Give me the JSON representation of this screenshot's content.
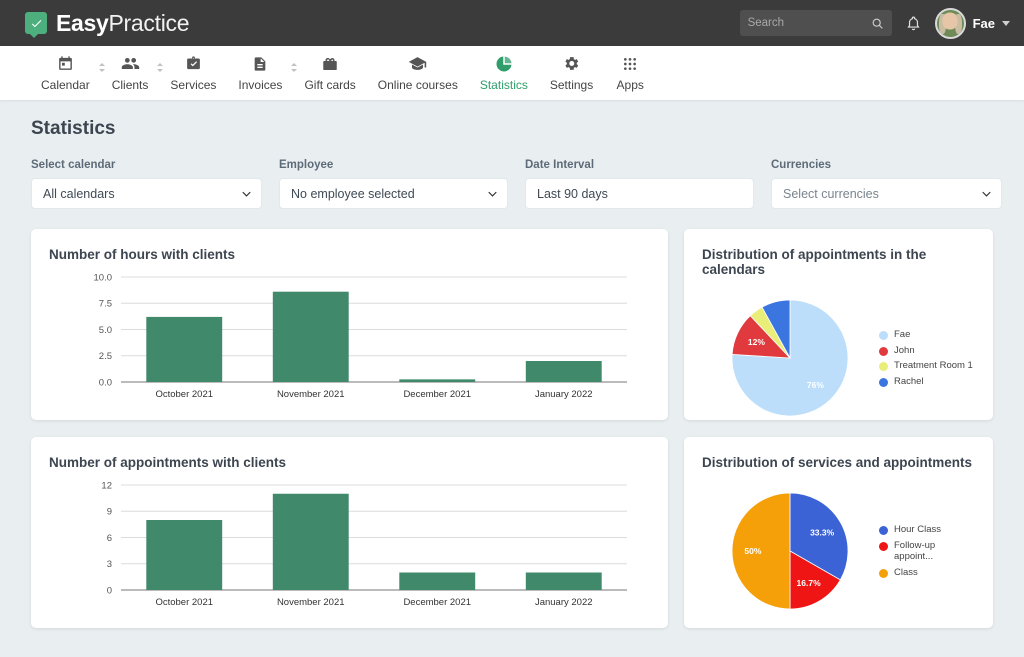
{
  "topbar": {
    "logo_bold": "Easy",
    "logo_light": "Practice",
    "logo_icon": "check-badge-icon",
    "search_placeholder": "Search",
    "search_value": "",
    "search_icon": "search-icon",
    "bell_icon": "notification-bell-icon",
    "user_name": "Fae",
    "user_caret_icon": "chevron-down-icon"
  },
  "nav": {
    "items": [
      {
        "label": "Calendar",
        "icon": "calendar-icon",
        "active": false,
        "has_stepper": true
      },
      {
        "label": "Clients",
        "icon": "people-icon",
        "active": false,
        "has_stepper": true
      },
      {
        "label": "Services",
        "icon": "briefcase-check-icon",
        "active": false,
        "has_stepper": false
      },
      {
        "label": "Invoices",
        "icon": "document-icon",
        "active": false,
        "has_stepper": true
      },
      {
        "label": "Gift cards",
        "icon": "gift-card-icon",
        "active": false,
        "has_stepper": false
      },
      {
        "label": "Online courses",
        "icon": "graduation-cap-icon",
        "active": false,
        "has_stepper": false
      },
      {
        "label": "Statistics",
        "icon": "pie-chart-icon",
        "active": true,
        "has_stepper": false
      },
      {
        "label": "Settings",
        "icon": "gear-icon",
        "active": false,
        "has_stepper": false
      },
      {
        "label": "Apps",
        "icon": "grid-apps-icon",
        "active": false,
        "has_stepper": false
      }
    ]
  },
  "page": {
    "title": "Statistics"
  },
  "filters": [
    {
      "label": "Select calendar",
      "value": "All calendars",
      "type": "select",
      "name": "select-calendar"
    },
    {
      "label": "Employee",
      "value": "No employee selected",
      "type": "select",
      "name": "employee"
    },
    {
      "label": "Date Interval",
      "value": "Last 90 days",
      "type": "text",
      "name": "date-interval"
    },
    {
      "label": "Currencies",
      "value": "Select currencies",
      "type": "select",
      "name": "currencies"
    }
  ],
  "cards": {
    "hours": {
      "title": "Number of hours with clients"
    },
    "appointments": {
      "title": "Number of appointments with clients"
    },
    "calendars_pie": {
      "title": "Distribution of appointments in the calendars"
    },
    "services_pie": {
      "title": "Distribution of services and appointments"
    }
  },
  "colors": {
    "bar_green": "#41896b",
    "brand_green": "#2f9e6b",
    "topbar": "#3b3b3b",
    "page_bg": "#e9eef1"
  },
  "chart_data": [
    {
      "id": "hours-bar-chart",
      "type": "bar",
      "title": "Number of hours with clients",
      "categories": [
        "October 2021",
        "November 2021",
        "December 2021",
        "January 2022"
      ],
      "values": [
        6.2,
        8.6,
        0.25,
        2.0
      ],
      "ytick_labels": [
        "0.0",
        "2.5",
        "5.0",
        "7.5",
        "10.0"
      ],
      "yticks": [
        0,
        2.5,
        5,
        7.5,
        10
      ],
      "ylim": [
        0,
        10
      ],
      "xlabel": "",
      "ylabel": "",
      "grid": true,
      "series_color": "#41896b"
    },
    {
      "id": "appointments-bar-chart",
      "type": "bar",
      "title": "Number of appointments with clients",
      "categories": [
        "October 2021",
        "November 2021",
        "December 2021",
        "January 2022"
      ],
      "values": [
        8,
        11,
        2,
        2
      ],
      "ytick_labels": [
        "0",
        "3",
        "6",
        "9",
        "12"
      ],
      "yticks": [
        0,
        3,
        6,
        9,
        12
      ],
      "ylim": [
        0,
        12
      ],
      "xlabel": "",
      "ylabel": "",
      "grid": true,
      "series_color": "#41896b"
    },
    {
      "id": "calendars-pie-chart",
      "type": "pie",
      "title": "Distribution of appointments in the calendars",
      "labels": [
        "Fae",
        "John",
        "Treatment Room 1",
        "Rachel"
      ],
      "values": [
        76,
        12,
        4,
        8
      ],
      "slice_labels": [
        "76%",
        "12%",
        "",
        ""
      ],
      "colors": [
        "#bcdefa",
        "#e03a3e",
        "#e9ee79",
        "#3b76e0"
      ],
      "legend_position": "right"
    },
    {
      "id": "services-pie-chart",
      "type": "pie",
      "title": "Distribution of services and appointments",
      "labels": [
        "Hour Class",
        "Follow-up appoint...",
        "Class"
      ],
      "values": [
        33.3,
        16.7,
        50
      ],
      "slice_labels": [
        "33.3%",
        "16.7%",
        "50%"
      ],
      "colors": [
        "#3b63d6",
        "#ef1515",
        "#f5a009"
      ],
      "legend_position": "right"
    }
  ]
}
